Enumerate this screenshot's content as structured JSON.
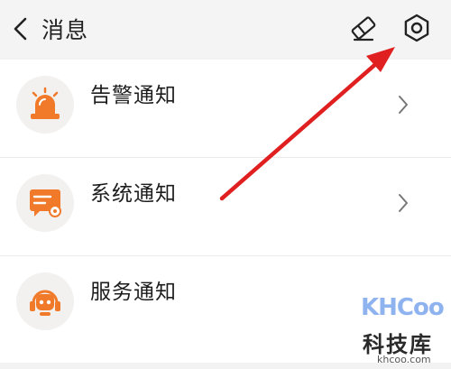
{
  "header": {
    "title": "消息",
    "back_icon": "chevron-left-icon",
    "eraser_icon": "eraser-icon",
    "settings_icon": "gear-icon"
  },
  "notifications": [
    {
      "label": "告警通知",
      "icon": "alarm-siren-icon",
      "icon_color": "#f07a2a"
    },
    {
      "label": "系统通知",
      "icon": "message-card-icon",
      "icon_color": "#f07a2a"
    },
    {
      "label": "服务通知",
      "icon": "robot-headset-icon",
      "icon_color": "#f07a2a"
    }
  ],
  "annotation": {
    "arrow_color": "#e02020",
    "points_to": "settings-button"
  },
  "watermark": {
    "logo": "KHCoo",
    "name": "科技库",
    "domain": "khcoo.com"
  },
  "colors": {
    "accent": "#f07a2a",
    "background": "#f2f2f2",
    "card": "#ffffff"
  }
}
